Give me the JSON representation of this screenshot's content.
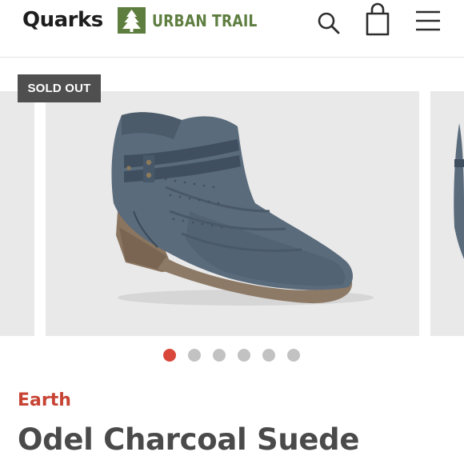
{
  "header": {
    "brand_logo": "Quarks",
    "partner_logo": "URBAN TRAIL",
    "icons": [
      "search-icon",
      "shopping-bag-icon",
      "hamburger-menu-icon"
    ]
  },
  "product": {
    "badge": "SOLD OUT",
    "brand": "Earth",
    "name": "Odel Charcoal Suede",
    "image": "charcoal-suede-ankle-boot"
  },
  "carousel": {
    "slide_count": 6,
    "active_index": 0
  },
  "colors": {
    "brand_dark": "#1d1d1d",
    "urban_trail_green": "#5e7e40",
    "accent_red": "#d9473b",
    "brand_text_red": "#c74435",
    "badge_bg": "#4f4f4f",
    "dot_inactive": "#c2c2c2",
    "image_bg": "#e9e9e9"
  }
}
